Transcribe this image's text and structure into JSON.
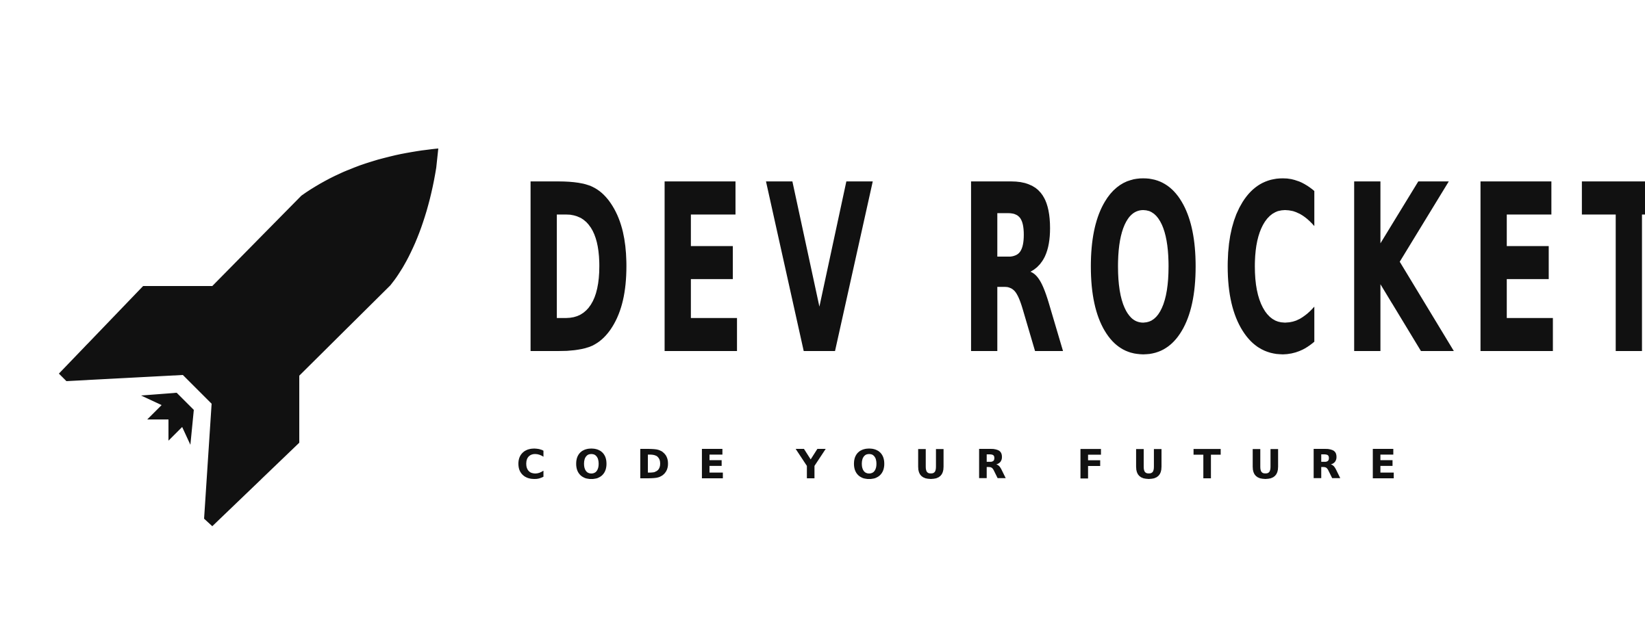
{
  "logo": {
    "wordmark": "DEV ROCKET",
    "tagline": "CODE YOUR FUTURE",
    "icon": "rocket-icon",
    "colors": {
      "ink": "#111111",
      "background": "#ffffff"
    }
  }
}
